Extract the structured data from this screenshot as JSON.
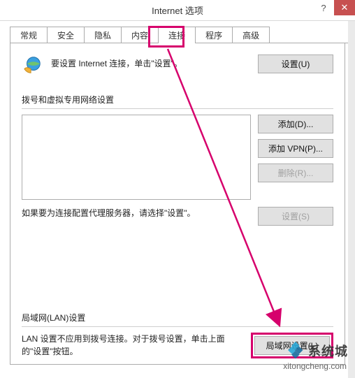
{
  "window": {
    "title": "Internet 选项",
    "help": "?",
    "close": "✕"
  },
  "tabs": {
    "t0": "常规",
    "t1": "安全",
    "t2": "隐私",
    "t3": "内容",
    "t4": "连接",
    "t5": "程序",
    "t6": "高级"
  },
  "top": {
    "text": "要设置 Internet 连接，单击\"设置\"。",
    "setup_btn": "设置(U)"
  },
  "dial": {
    "label": "拨号和虚拟专用网络设置",
    "add_btn": "添加(D)...",
    "add_vpn_btn": "添加 VPN(P)...",
    "remove_btn": "删除(R)...",
    "proxy_text": "如果要为连接配置代理服务器，请选择\"设置\"。",
    "settings_btn": "设置(S)"
  },
  "lan": {
    "label": "局域网(LAN)设置",
    "text": "LAN 设置不应用到拨号连接。对于拨号设置，单击上面的\"设置\"按钮。",
    "btn": "局域网设置(L)"
  },
  "watermark": {
    "text": "系统城",
    "url": "xitongcheng.com"
  },
  "annotation": {
    "color": "#d6006c"
  }
}
